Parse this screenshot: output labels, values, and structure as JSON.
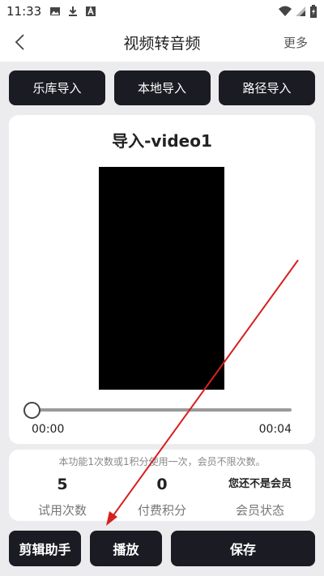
{
  "status_bar": {
    "time": "11:33",
    "left_icons": [
      "image-icon",
      "download-icon",
      "a-box-icon"
    ],
    "right_icons": [
      "wifi-icon",
      "signal-icon",
      "battery-icon"
    ]
  },
  "header": {
    "title": "视频转音频",
    "more_label": "更多",
    "back_icon": "chevron-left-icon"
  },
  "import_buttons": [
    {
      "label": "乐库导入"
    },
    {
      "label": "本地导入"
    },
    {
      "label": "路径导入"
    }
  ],
  "player": {
    "title": "导入-video1",
    "progress": 0,
    "current_time": "00:00",
    "total_time": "00:04"
  },
  "info": {
    "note": "本功能1次数或1积分使用一次，会员不限次数。",
    "stats": [
      {
        "value": "5",
        "label": "试用次数"
      },
      {
        "value": "0",
        "label": "付费积分"
      },
      {
        "value": "您还不是会员",
        "label": "会员状态"
      }
    ]
  },
  "bottom_buttons": {
    "edit_label": "剪辑助手",
    "play_label": "播放",
    "save_label": "保存"
  },
  "colors": {
    "dark_button": "#1b1b23",
    "background": "#ececef",
    "annotation_arrow": "#d62020"
  }
}
